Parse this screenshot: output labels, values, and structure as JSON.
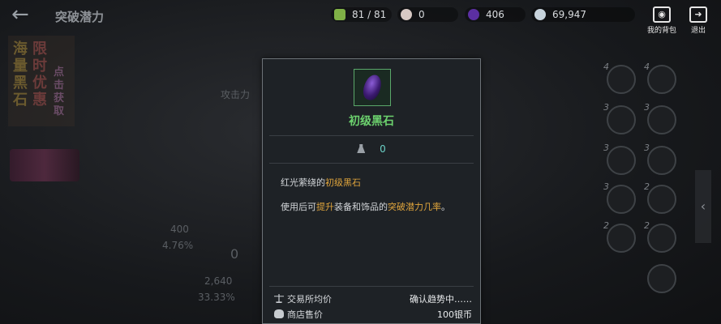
{
  "header": {
    "title": "突破潜力",
    "back_icon": "arrow-left-icon"
  },
  "resources": {
    "stamina": "81 / 81",
    "pearl": "0",
    "orb": "406",
    "silver": "69,947"
  },
  "top_actions": {
    "bag_label": "我的背包",
    "exit_label": "退出"
  },
  "promo": {
    "col_a": "海量黑石",
    "col_b": "限时优惠",
    "col_c": "点击获取"
  },
  "background_texts": {
    "attack_label": "攻击力",
    "val_a": "400",
    "pct_a": "4.76%",
    "val_b": "0",
    "val_c": "2,640",
    "pct_c": "33.33%"
  },
  "slots": [
    {
      "lvl": "4"
    },
    {
      "lvl": "4"
    },
    {
      "lvl": "3"
    },
    {
      "lvl": "3"
    },
    {
      "lvl": "3"
    },
    {
      "lvl": "3"
    },
    {
      "lvl": "3"
    },
    {
      "lvl": "2"
    },
    {
      "lvl": "2"
    },
    {
      "lvl": "2"
    },
    {
      "lvl": ""
    }
  ],
  "popup": {
    "item_name": "初级黑石",
    "count": "0",
    "desc1_prefix": "红光萦绕的",
    "desc1_highlight": "初级黑石",
    "desc2_a": "使用后可",
    "desc2_b": "提升",
    "desc2_c": "装备和饰品的",
    "desc2_d": "突破潜力几率",
    "desc2_e": "。",
    "trade_label": "交易所均价",
    "trade_value": "确认趋势中……",
    "shop_label": "商店售价",
    "shop_value": "100银币"
  },
  "colors": {
    "item_name": "#6cd26e",
    "highlight": "#e0a53c",
    "count": "#6cd2c7"
  }
}
